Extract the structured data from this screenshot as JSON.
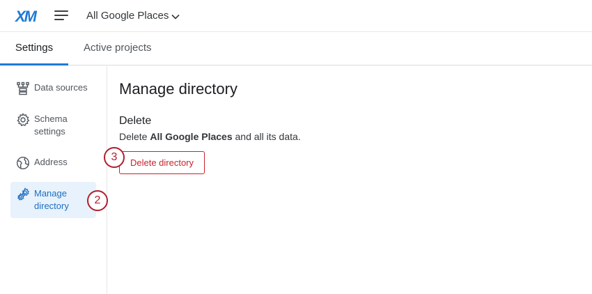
{
  "header": {
    "logo": "XM",
    "directory_name": "All Google Places"
  },
  "tabs": [
    {
      "label": "Settings",
      "active": true
    },
    {
      "label": "Active projects",
      "active": false
    }
  ],
  "sidebar": {
    "items": [
      {
        "label": "Data sources",
        "icon": "data-sources-icon"
      },
      {
        "label": "Schema settings",
        "icon": "gear-icon"
      },
      {
        "label": "Address",
        "icon": "globe-icon"
      },
      {
        "label": "Manage directory",
        "icon": "gears-icon",
        "active": true
      }
    ]
  },
  "main": {
    "title": "Manage directory",
    "section_title": "Delete",
    "description_prefix": "Delete ",
    "description_bold": "All Google Places",
    "description_suffix": " and all its data.",
    "delete_button": "Delete directory"
  },
  "badges": {
    "sidebar_step": "2",
    "button_step": "3"
  },
  "colors": {
    "accent": "#1e7ad6",
    "danger": "#c8232c",
    "badge": "#b01e2e",
    "active_bg": "#e8f2fc"
  }
}
